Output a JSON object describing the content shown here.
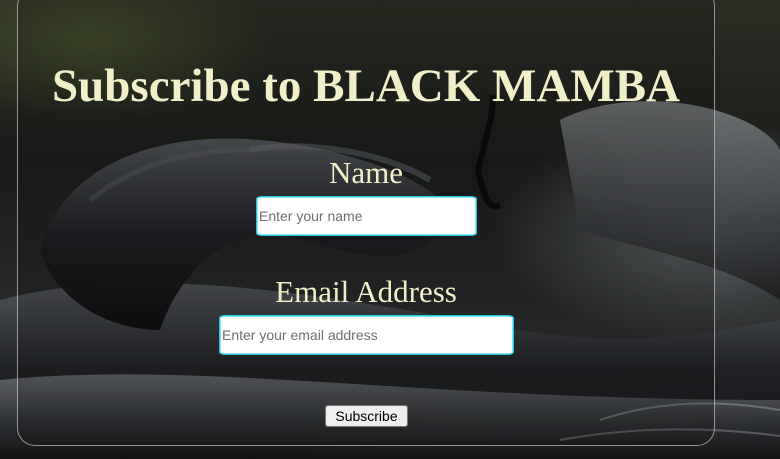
{
  "page": {
    "title": "Subscribe to BLACK MAMBA"
  },
  "form": {
    "name_label": "Name",
    "name_placeholder": "Enter your name",
    "email_label": "Email Address",
    "email_placeholder": "Enter your email address",
    "submit_label": "Subscribe"
  },
  "theme": {
    "text_color": "#f1efc9",
    "input_border": "#25c7de"
  }
}
